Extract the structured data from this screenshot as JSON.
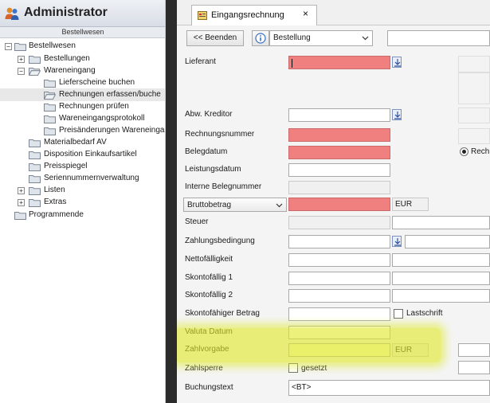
{
  "admin": {
    "title": "Administrator"
  },
  "nav": {
    "section": "Bestellwesen",
    "tree": {
      "root": "Bestellwesen",
      "bestellungen": "Bestellungen",
      "wareneingang": "Wareneingang",
      "lieferscheine": "Lieferscheine buchen",
      "rechnungen_erfassen": "Rechnungen erfassen/buche",
      "rechnungen_pruefen": "Rechnungen prüfen",
      "protokoll": "Wareneingangsprotokoll",
      "preisaenderungen": "Preisänderungen Wareneinga",
      "materialbedarf": "Materialbedarf AV",
      "disposition": "Disposition Einkaufsartikel",
      "preisspiegel": "Preisspiegel",
      "seriennummern": "Seriennummernverwaltung",
      "listen": "Listen",
      "extras": "Extras",
      "programmende": "Programmende"
    }
  },
  "tab": {
    "label": "Eingangsrechnung",
    "close": "×"
  },
  "toolbar": {
    "beenden": "<< Beenden",
    "select_value": "Bestellung"
  },
  "form": {
    "lieferant": "Lieferant",
    "abw_kreditor": "Abw. Kreditor",
    "rechnungsnummer": "Rechnungsnummer",
    "belegdatum": "Belegdatum",
    "leistungsdatum": "Leistungsdatum",
    "interne_belegnummer": "Interne Belegnummer",
    "bruttobetrag": "Bruttobetrag",
    "bruttobetrag_currency": "EUR",
    "steuer": "Steuer",
    "zahlungsbedingung": "Zahlungsbedingung",
    "nettofaelligkeit": "Nettofälligkeit",
    "skontofaellig1": "Skontofällig 1",
    "skontofaellig2": "Skontofällig 2",
    "skontofaehiger_betrag": "Skontofähiger Betrag",
    "lastschrift": "Lastschrift",
    "valuta_datum": "Valuta Datum",
    "zahlvorgabe": "Zahlvorgabe",
    "zahlvorgabe_currency": "EUR",
    "zahlsperre": "Zahlsperre",
    "gesetzt": "gesetzt",
    "buchungstext": "Buchungstext",
    "buchungstext_value": "<BT>",
    "rech_radio": "Rech"
  },
  "colors": {
    "required": "#f08080",
    "highlight": "#dee928"
  }
}
